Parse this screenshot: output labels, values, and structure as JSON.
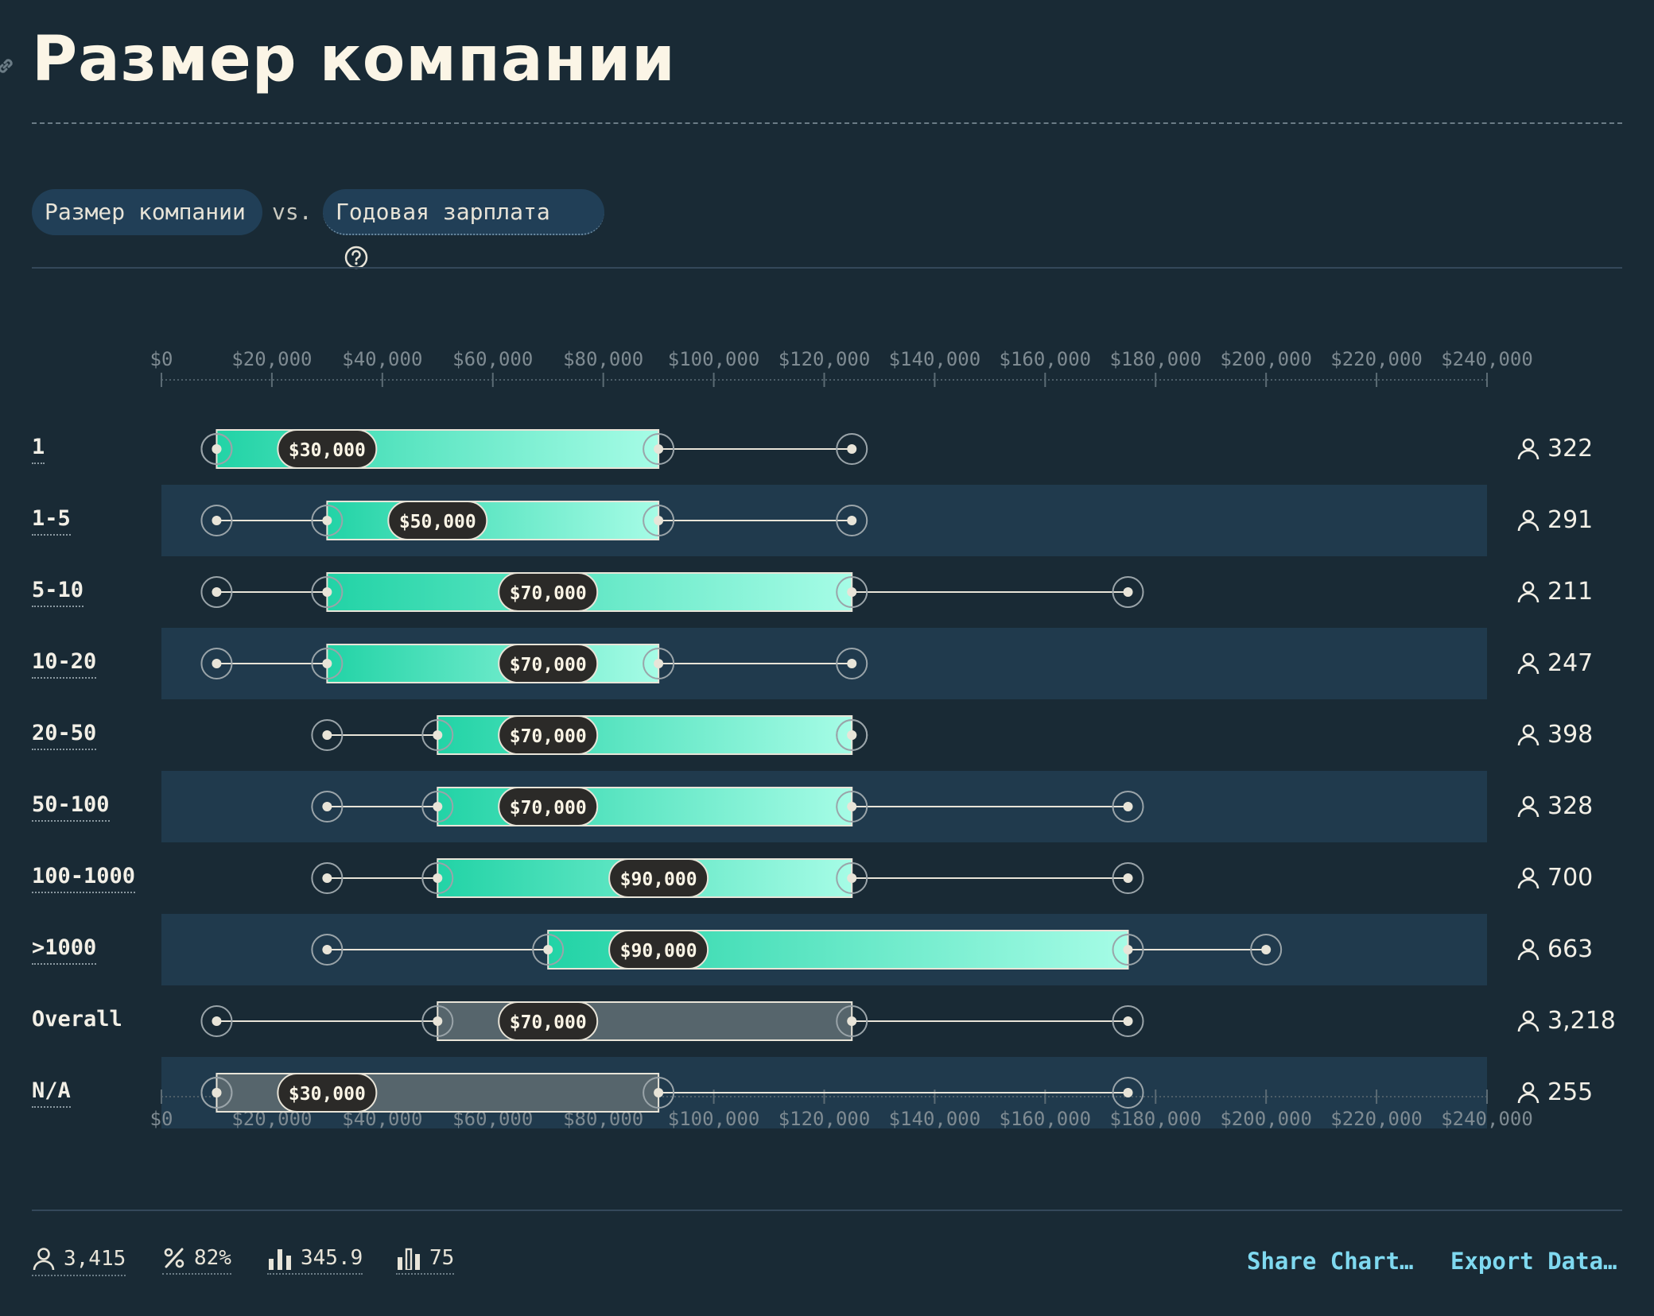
{
  "title": "Размер компании",
  "filters": {
    "dimension": "Размер компании",
    "vs": "vs.",
    "metric": "Годовая зарплата"
  },
  "chart_data": {
    "type": "boxplot",
    "x_ticks": [
      "$0",
      "$20,000",
      "$40,000",
      "$60,000",
      "$80,000",
      "$100,000",
      "$120,000",
      "$140,000",
      "$160,000",
      "$180,000",
      "$200,000",
      "$220,000",
      "$240,000"
    ],
    "xlim": [
      0,
      240000
    ],
    "rows": [
      {
        "label": "1",
        "min": 10000,
        "q1": 10000,
        "median": 30000,
        "q3": 90000,
        "max": 125000,
        "median_label": "$30,000",
        "count": "322",
        "style": "highlight"
      },
      {
        "label": "1-5",
        "min": 10000,
        "q1": 30000,
        "median": 50000,
        "q3": 90000,
        "max": 125000,
        "median_label": "$50,000",
        "count": "291",
        "style": "highlight"
      },
      {
        "label": "5-10",
        "min": 10000,
        "q1": 30000,
        "median": 70000,
        "q3": 125000,
        "max": 175000,
        "median_label": "$70,000",
        "count": "211",
        "style": "highlight"
      },
      {
        "label": "10-20",
        "min": 10000,
        "q1": 30000,
        "median": 70000,
        "q3": 90000,
        "max": 125000,
        "median_label": "$70,000",
        "count": "247",
        "style": "highlight"
      },
      {
        "label": "20-50",
        "min": 30000,
        "q1": 50000,
        "median": 70000,
        "q3": 125000,
        "max": 125000,
        "median_label": "$70,000",
        "count": "398",
        "style": "highlight"
      },
      {
        "label": "50-100",
        "min": 30000,
        "q1": 50000,
        "median": 70000,
        "q3": 125000,
        "max": 175000,
        "median_label": "$70,000",
        "count": "328",
        "style": "highlight"
      },
      {
        "label": "100-1000",
        "min": 30000,
        "q1": 50000,
        "median": 90000,
        "q3": 125000,
        "max": 175000,
        "median_label": "$90,000",
        "count": "700",
        "style": "highlight"
      },
      {
        "label": ">1000",
        "min": 30000,
        "q1": 70000,
        "median": 90000,
        "q3": 175000,
        "max": 200000,
        "median_label": "$90,000",
        "count": "663",
        "style": "highlight"
      },
      {
        "label": "Overall",
        "min": 10000,
        "q1": 50000,
        "median": 70000,
        "q3": 125000,
        "max": 175000,
        "median_label": "$70,000",
        "count": "3,218",
        "style": "neutral"
      },
      {
        "label": "N/A",
        "min": 10000,
        "q1": 10000,
        "median": 30000,
        "q3": 90000,
        "max": 175000,
        "median_label": "$30,000",
        "count": "255",
        "style": "neutral"
      }
    ],
    "colors": {
      "box_start": "#22d3a6",
      "box_end": "#a6fce6",
      "neutral_box": "#56656c",
      "band": "#203a4d"
    }
  },
  "footer": {
    "respondents": "3,415",
    "percent": "82%",
    "average": "345.9",
    "bins": "75",
    "share_label": "Share Chart…",
    "export_label": "Export Data…"
  }
}
